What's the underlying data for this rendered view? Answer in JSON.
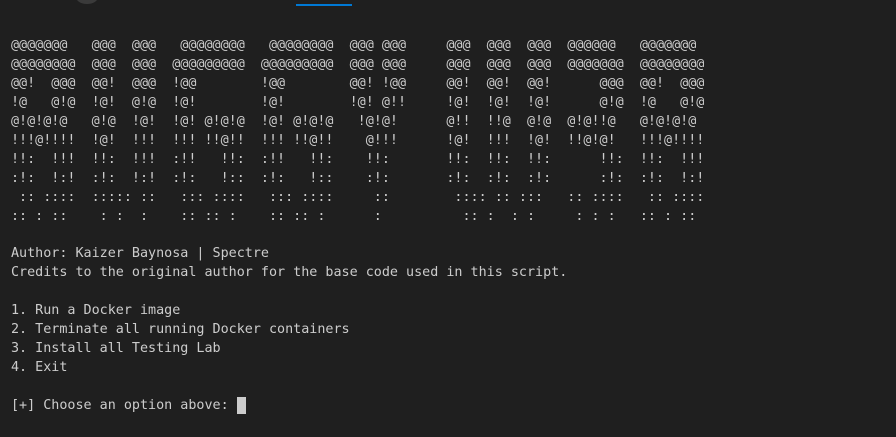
{
  "banner": {
    "lines": [
      "@@@@@@@   @@@  @@@   @@@@@@@@   @@@@@@@@  @@@ @@@     @@@  @@@  @@@  @@@@@@   @@@@@@@",
      "@@@@@@@@  @@@  @@@  @@@@@@@@@  @@@@@@@@@  @@@ @@@     @@@  @@@  @@@  @@@@@@@  @@@@@@@@",
      "@@!  @@@  @@!  @@@  !@@        !@@        @@! !@@     @@!  @@!  @@!      @@@  @@!  @@@",
      "!@   @!@  !@!  @!@  !@!        !@!        !@! @!!     !@!  !@!  !@!      @!@  !@   @!@",
      "@!@!@!@   @!@  !@!  !@! @!@!@  !@! @!@!@   !@!@!      @!!  !!@  @!@  @!@!!@   @!@!@!@",
      "!!!@!!!!  !@!  !!!  !!! !!@!!  !!! !!@!!    @!!!      !@!  !!!  !@!  !!@!@!   !!!@!!!!",
      "!!:  !!!  !!:  !!!  :!!   !!:  :!!   !!:    !!:       !!:  !!:  !!:      !!:  !!:  !!!",
      ":!:  !:!  :!:  !:!  :!:   !::  :!:   !::    :!:       :!:  :!:  :!:      :!:  :!:  !:!",
      " :: ::::  ::::: ::   ::: ::::   ::: ::::     ::        :::: :: :::   :: ::::   :: ::::",
      ":: : ::    : :  :    :: :: :    :: :: :      :          :: :  : :     : : :   :: : ::"
    ]
  },
  "info": {
    "author": "Author: Kaizer Baynosa | Spectre",
    "credits": "Credits to the original author for the base code used in this script."
  },
  "menu": {
    "items": [
      {
        "label": "1. Run a Docker image"
      },
      {
        "label": "2. Terminate all running Docker containers"
      },
      {
        "label": "3. Install all Testing Lab"
      },
      {
        "label": "4. Exit"
      }
    ]
  },
  "prompt": {
    "text": "[+] Choose an option above:"
  },
  "colors": {
    "background": "#1f1f1f",
    "foreground": "#cccccc",
    "accent": "#0078d4"
  }
}
